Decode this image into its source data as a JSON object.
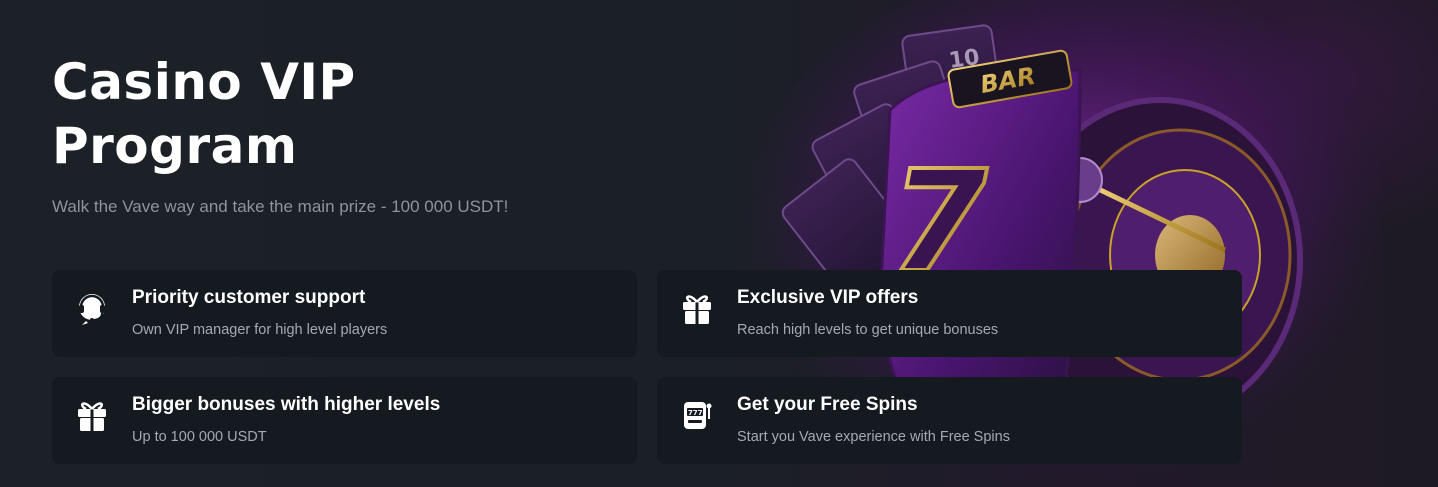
{
  "hero": {
    "title": "Casino VIP Program",
    "subtitle": "Walk the Vave way and take the main prize - 100 000 USDT!"
  },
  "features": [
    {
      "icon": "headset-icon",
      "title": "Priority customer support",
      "text": "Own VIP manager for high level players"
    },
    {
      "icon": "gift-icon",
      "title": "Exclusive VIP offers",
      "text": "Reach high levels to get unique bonuses"
    },
    {
      "icon": "gift-icon",
      "title": "Bigger bonuses with higher levels",
      "text": "Up to 100 000 USDT"
    },
    {
      "icon": "slot-machine-icon",
      "title": "Get your Free Spins",
      "text": "Start you Vave experience with Free Spins"
    }
  ],
  "art": {
    "slot_label": "BAR",
    "slot_number": "7",
    "card_rank": "10"
  },
  "colors": {
    "background": "#1a1f25",
    "card_background": "#141a20",
    "accent_purple": "#6b1f8c",
    "gold": "#c9a227"
  }
}
